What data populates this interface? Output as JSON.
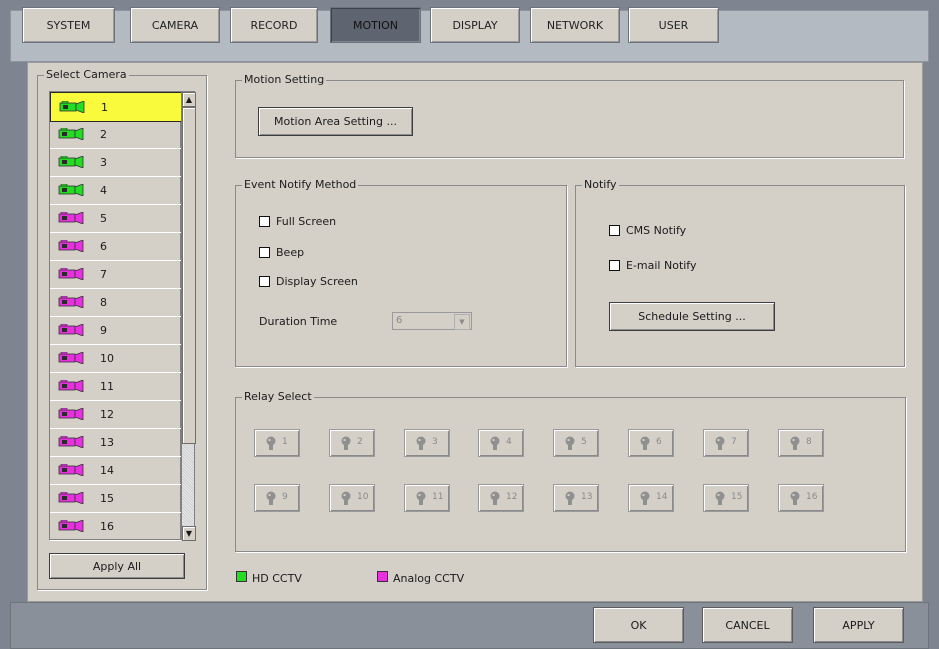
{
  "tabs": [
    {
      "label": "SYSTEM"
    },
    {
      "label": "CAMERA"
    },
    {
      "label": "RECORD"
    },
    {
      "label": "MOTION"
    },
    {
      "label": "DISPLAY"
    },
    {
      "label": "NETWORK"
    },
    {
      "label": "USER"
    }
  ],
  "active_tab": "MOTION",
  "select_camera": {
    "title": "Select Camera",
    "selected": "1",
    "cameras": [
      {
        "label": "1",
        "type": "hd"
      },
      {
        "label": "2",
        "type": "hd"
      },
      {
        "label": "3",
        "type": "hd"
      },
      {
        "label": "4",
        "type": "hd"
      },
      {
        "label": "5",
        "type": "analog"
      },
      {
        "label": "6",
        "type": "analog"
      },
      {
        "label": "7",
        "type": "analog"
      },
      {
        "label": "8",
        "type": "analog"
      },
      {
        "label": "9",
        "type": "analog"
      },
      {
        "label": "10",
        "type": "analog"
      },
      {
        "label": "11",
        "type": "analog"
      },
      {
        "label": "12",
        "type": "analog"
      },
      {
        "label": "13",
        "type": "analog"
      },
      {
        "label": "14",
        "type": "analog"
      },
      {
        "label": "15",
        "type": "analog"
      },
      {
        "label": "16",
        "type": "analog"
      }
    ],
    "apply_all_label": "Apply All"
  },
  "motion_setting": {
    "title": "Motion Setting",
    "area_button_label": "Motion Area Setting ..."
  },
  "event_notify": {
    "title": "Event Notify Method",
    "full_screen_label": "Full Screen",
    "beep_label": "Beep",
    "display_screen_label": "Display Screen",
    "duration_label": "Duration Time",
    "duration_value": "6"
  },
  "notify": {
    "title": "Notify",
    "cms_label": "CMS Notify",
    "email_label": "E-mail Notify",
    "schedule_button_label": "Schedule Setting ..."
  },
  "relay_select": {
    "title": "Relay Select",
    "relays": [
      "1",
      "2",
      "3",
      "4",
      "5",
      "6",
      "7",
      "8",
      "9",
      "10",
      "11",
      "12",
      "13",
      "14",
      "15",
      "16"
    ]
  },
  "camera_legend": {
    "hd_label": "HD CCTV",
    "analog_label": "Analog CCTV"
  },
  "footer": {
    "ok_label": "OK",
    "cancel_label": "CANCEL",
    "apply_label": "APPLY"
  },
  "colors": {
    "hd": "#22dd22",
    "analog": "#e830e0",
    "selected_row": "#fafa3c"
  },
  "icons": {
    "camera": "camera-icon",
    "relay": "relay-bulb-icon",
    "scroll_up": "scroll-up-icon",
    "scroll_down": "scroll-down-icon",
    "dropdown": "chevron-down-icon"
  }
}
